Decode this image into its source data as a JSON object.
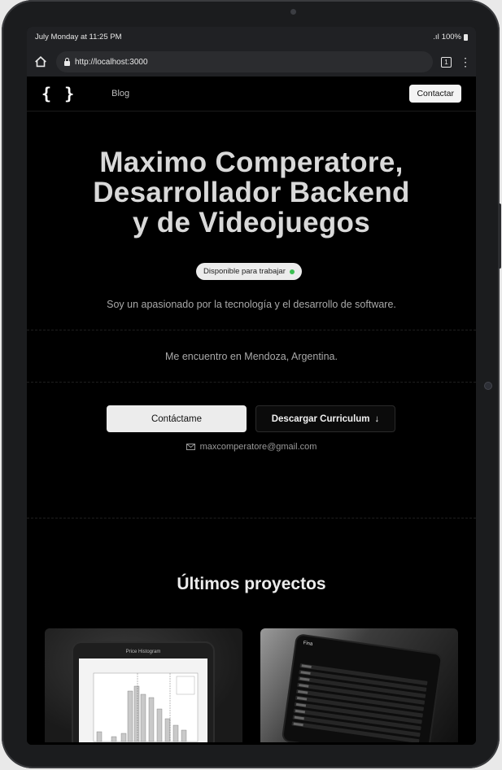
{
  "device": {
    "status": {
      "time_text": "July Monday at 11:25 PM",
      "battery": "100%"
    },
    "browser": {
      "url": "http://localhost:3000",
      "tab_count": "1"
    }
  },
  "nav": {
    "logo": "{ }",
    "blog_label": "Blog",
    "contact_label": "Contactar"
  },
  "hero": {
    "title_line1": "Maximo Comperatore,",
    "title_line2": "Desarrollador Backend",
    "title_line3": "y de Videojuegos",
    "badge": "Disponible para trabajar",
    "tagline": "Soy un apasionado por la tecnología y el desarrollo de software.",
    "location": "Me encuentro en Mendoza, Argentina.",
    "cta_primary": "Contáctame",
    "cta_secondary": "Descargar Curriculum",
    "email": "maxcomperatore@gmail.com"
  },
  "projects": {
    "title": "Últimos proyectos",
    "cards": [
      {
        "preview_caption": "Price Histogram"
      },
      {
        "preview_caption": "Fina"
      }
    ]
  },
  "colors": {
    "background": "#000000",
    "available_dot": "#3cbf52"
  }
}
